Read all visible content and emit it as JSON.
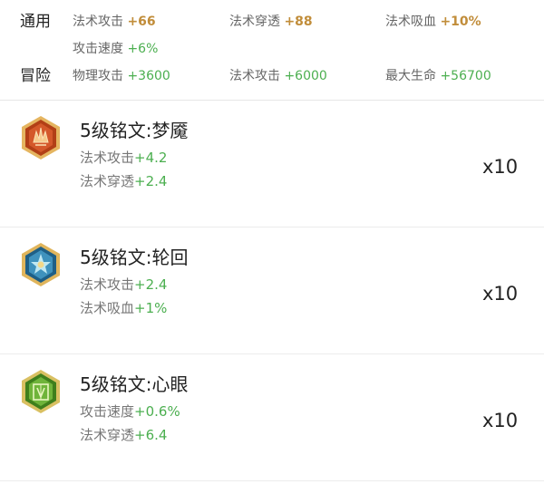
{
  "summary": {
    "general": {
      "label": "通用",
      "stats": [
        {
          "name": "法术攻击",
          "value": "+66"
        },
        {
          "name": "法术穿透",
          "value": "+88"
        },
        {
          "name": "法术吸血",
          "value": "+10%"
        },
        {
          "name": "攻击速度",
          "value": "+6%"
        }
      ]
    },
    "adventure": {
      "label": "冒险",
      "stats": [
        {
          "name": "物理攻击",
          "value": "+3600"
        },
        {
          "name": "法术攻击",
          "value": "+6000"
        },
        {
          "name": "最大生命",
          "value": "+56700"
        }
      ]
    }
  },
  "runes": [
    {
      "title": "5级铭文:梦魇",
      "icon": "nightmare-rune-icon",
      "color": "#b84a1e",
      "stats": [
        {
          "name": "法术攻击",
          "value": "+4.2"
        },
        {
          "name": "法术穿透",
          "value": "+2.4"
        }
      ],
      "count": "x10"
    },
    {
      "title": "5级铭文:轮回",
      "icon": "reincarnation-rune-icon",
      "color": "#2f7fa8",
      "stats": [
        {
          "name": "法术攻击",
          "value": "+2.4"
        },
        {
          "name": "法术吸血",
          "value": "+1%"
        }
      ],
      "count": "x10"
    },
    {
      "title": "5级铭文:心眼",
      "icon": "mind-eye-rune-icon",
      "color": "#5a9a2a",
      "stats": [
        {
          "name": "攻击速度",
          "value": "+0.6%"
        },
        {
          "name": "法术穿透",
          "value": "+6.4"
        }
      ],
      "count": "x10"
    }
  ]
}
